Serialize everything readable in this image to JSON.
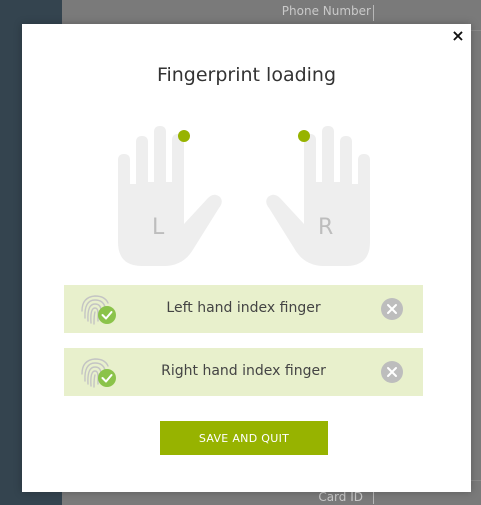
{
  "background": {
    "phone_label": "Phone Number",
    "card_label": "Card ID"
  },
  "modal": {
    "title": "Fingerprint loading",
    "close_glyph": "×",
    "left_hand_letter": "L",
    "right_hand_letter": "R",
    "rows": [
      {
        "label": "Left hand index finger",
        "status": "captured"
      },
      {
        "label": "Right hand index finger",
        "status": "captured"
      }
    ],
    "save_label": "SAVE AND QUIT"
  },
  "colors": {
    "accent": "#97b300",
    "row_bg": "#e8f0cc",
    "check": "#8bc34a",
    "hand": "#eeeeee",
    "remove": "#bdbdbd"
  },
  "icons": {
    "close": "close-icon",
    "fingerprint": "fingerprint-icon",
    "check": "check-icon",
    "remove": "remove-circle-icon"
  }
}
